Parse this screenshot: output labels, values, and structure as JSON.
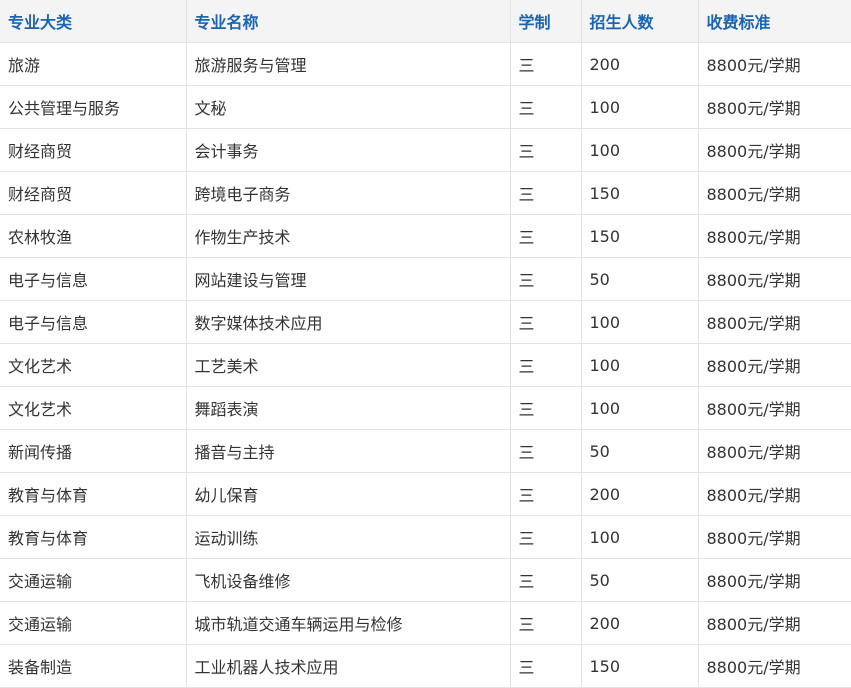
{
  "table": {
    "headers": [
      "专业大类",
      "专业名称",
      "学制",
      "招生人数",
      "收费标准"
    ],
    "rows": [
      [
        "旅游",
        "旅游服务与管理",
        "三",
        "200",
        "8800元/学期"
      ],
      [
        "公共管理与服务",
        "文秘",
        "三",
        "100",
        "8800元/学期"
      ],
      [
        "财经商贸",
        "会计事务",
        "三",
        "100",
        "8800元/学期"
      ],
      [
        "财经商贸",
        "跨境电子商务",
        "三",
        "150",
        "8800元/学期"
      ],
      [
        "农林牧渔",
        "作物生产技术",
        "三",
        "150",
        "8800元/学期"
      ],
      [
        "电子与信息",
        "网站建设与管理",
        "三",
        "50",
        "8800元/学期"
      ],
      [
        "电子与信息",
        "数字媒体技术应用",
        "三",
        "100",
        "8800元/学期"
      ],
      [
        "文化艺术",
        "工艺美术",
        "三",
        "100",
        "8800元/学期"
      ],
      [
        "文化艺术",
        "舞蹈表演",
        "三",
        "100",
        "8800元/学期"
      ],
      [
        "新闻传播",
        "播音与主持",
        "三",
        "50",
        "8800元/学期"
      ],
      [
        "教育与体育",
        "幼儿保育",
        "三",
        "200",
        "8800元/学期"
      ],
      [
        "教育与体育",
        "运动训练",
        "三",
        "100",
        "8800元/学期"
      ],
      [
        "交通运输",
        "飞机设备维修",
        "三",
        "50",
        "8800元/学期"
      ],
      [
        "交通运输",
        "城市轨道交通车辆运用与检修",
        "三",
        "200",
        "8800元/学期"
      ],
      [
        "装备制造",
        "工业机器人技术应用",
        "三",
        "150",
        "8800元/学期"
      ]
    ]
  }
}
